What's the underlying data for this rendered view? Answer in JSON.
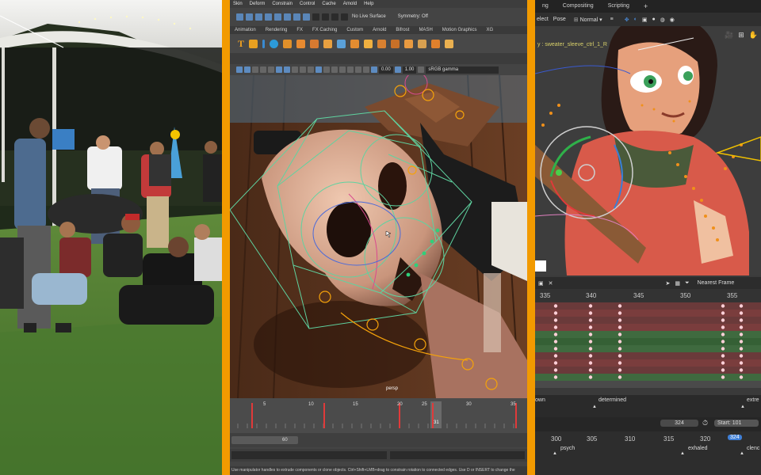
{
  "maya": {
    "menu": [
      "Skin",
      "Deform",
      "Constrain",
      "Control",
      "Cache",
      "Arnold",
      "Help"
    ],
    "live_surface": "No Live Surface",
    "symmetry": "Symmetry: Off",
    "shelf_tabs": [
      "Animation",
      "Rendering",
      "FX",
      "FX Caching",
      "Custom",
      "Arnold",
      "Bifrost",
      "MASH",
      "Motion Graphics",
      "XG"
    ],
    "value_a": "0.00",
    "value_b": "1.00",
    "colorspace": "sRGB gamma",
    "camera": "persp",
    "timeline_ticks": [
      "5",
      "10",
      "15",
      "20",
      "25",
      "30",
      "35"
    ],
    "current_frame": "31",
    "range_end": "60",
    "help_line": "Use manipulator handles to extrude components or clone objects. Ctrl+Shift+LMB+drag to constrain rotation to connected edges. Use D or INSERT to change the"
  },
  "blender": {
    "tabs": [
      "ng",
      "Compositing",
      "Scripting"
    ],
    "select": "elect",
    "pose": "Pose",
    "blend_mode": "Normal",
    "object_name": "y : sweater_sleeve_ctrl_1_R",
    "snap_mode": "Nearest Frame",
    "dope_ruler": [
      "335",
      "340",
      "345",
      "350",
      "355"
    ],
    "markers": [
      "own",
      "determined",
      "extre"
    ],
    "current_frame": "324",
    "start_label": "Start:",
    "start_value": "101",
    "graph_ruler": [
      "300",
      "305",
      "310",
      "315",
      "320"
    ],
    "graph_current": "324",
    "graph_markers": [
      "psych",
      "exhaled",
      "clenc"
    ]
  },
  "colors": {
    "divider": "#f29a00",
    "maya_select_blue": "#5a86b8",
    "blender_keyframe": "#e8e8e8",
    "blender_row_red": "#7a3a3a",
    "blender_row_green": "#3d6b3d"
  }
}
